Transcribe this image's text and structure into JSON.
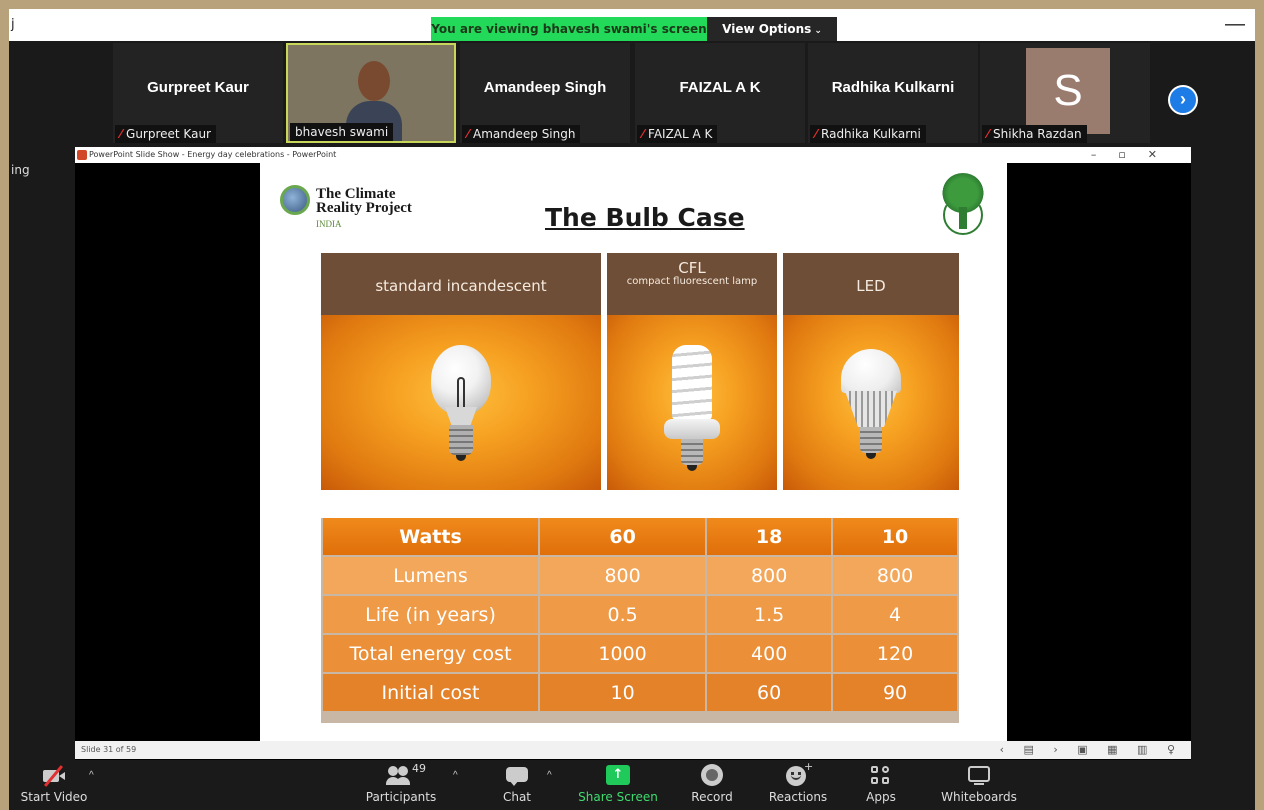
{
  "meeting": {
    "banner_text": "You are viewing bhavesh swami's screen",
    "view_options_label": "View Options",
    "top_edge_char": "j",
    "minimize_glyph": "—",
    "side_label": "ing"
  },
  "participants": [
    {
      "display_name": "Gurpreet Kaur",
      "caption": "Gurpreet Kaur",
      "muted": true
    },
    {
      "display_name": "",
      "caption": "bhavesh swami",
      "muted": false,
      "video": true
    },
    {
      "display_name": "Amandeep Singh",
      "caption": "Amandeep Singh",
      "muted": true
    },
    {
      "display_name": "FAIZAL A K",
      "caption": "FAIZAL A K",
      "muted": true
    },
    {
      "display_name": "Radhika Kulkarni",
      "caption": "Radhika Kulkarni",
      "muted": true
    },
    {
      "display_name": "",
      "caption": "Shikha Razdan",
      "muted": true,
      "avatar_letter": "S"
    }
  ],
  "mute_glyph": "⁄",
  "next_glyph": "›",
  "powerpoint": {
    "window_title": "PowerPoint Slide Show  -  Energy day celebrations - PowerPoint",
    "window_controls": "–▫✕",
    "status_text": "Slide 31 of 59",
    "status_controls": "‹ ▤ › ▣ ▦ ▥ ♀"
  },
  "slide": {
    "logo_line1": "The Climate",
    "logo_line2": "Reality Project",
    "logo_line3": "INDIA",
    "title": "The Bulb Case",
    "panels": [
      {
        "label": "standard incandescent",
        "sublabel": ""
      },
      {
        "label": "CFL",
        "sublabel": "compact fluorescent lamp"
      },
      {
        "label": "LED",
        "sublabel": ""
      }
    ],
    "table": {
      "header": {
        "label": "Watts",
        "values": [
          "60",
          "18",
          "10"
        ]
      },
      "rows": [
        {
          "label": "Lumens",
          "values": [
            "800",
            "800",
            "800"
          ]
        },
        {
          "label": "Life (in years)",
          "values": [
            "0.5",
            "1.5",
            "4"
          ]
        },
        {
          "label": "Total energy cost",
          "values": [
            "1000",
            "400",
            "120"
          ]
        },
        {
          "label": "Initial cost",
          "values": [
            "10",
            "60",
            "90"
          ]
        }
      ]
    }
  },
  "toolbar": {
    "start_video": "Start Video",
    "participants": "Participants",
    "participants_count": "49",
    "chat": "Chat",
    "share_screen": "Share Screen",
    "record": "Record",
    "reactions": "Reactions",
    "apps": "Apps",
    "whiteboards": "Whiteboards",
    "caret": "^",
    "share_arrow": "↑",
    "reaction_plus": "+"
  },
  "colors": {
    "frame": "#b8a27c",
    "banner_green": "#23d959",
    "share_green": "#1fc95a",
    "panel_header_brown": "#6e4e36",
    "table_orange": "#e06f0a",
    "mute_red": "#e03030",
    "next_blue": "#1e7ce6"
  }
}
